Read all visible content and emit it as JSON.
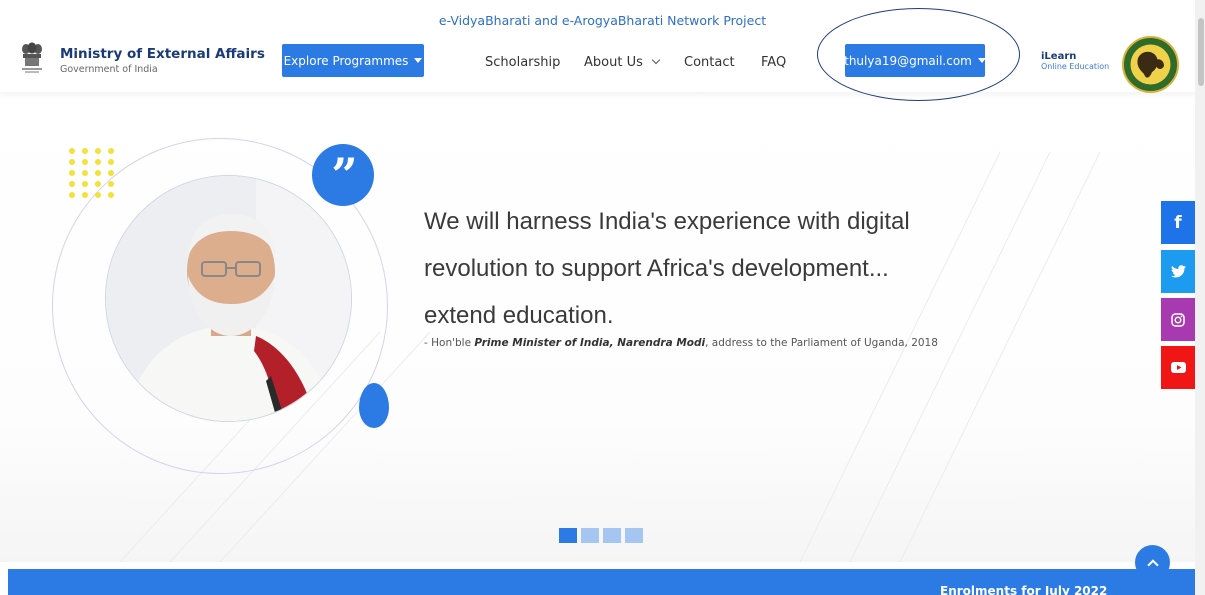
{
  "header": {
    "project_title": "e-VidyaBharati and e-ArogyaBharati Network Project",
    "ministry_name": "Ministry of External Affairs",
    "ministry_sub": "Government of India",
    "explore_label": "Explore Programmes",
    "nav": {
      "scholarship": "Scholarship",
      "about": "About Us",
      "contact": "Contact",
      "faq": "FAQ"
    },
    "user_email": "thulya19@gmail.com",
    "ilearn_title": "iLearn",
    "ilearn_sub": "Online Education"
  },
  "hero": {
    "quote_lines": [
      "We will harness India's experience with digital",
      "revolution to support Africa's development...",
      "extend education."
    ],
    "attribution_prefix": "- Hon'ble ",
    "attribution_name": "Prime Minister of India, Narendra Modi",
    "attribution_suffix": ", address to the Parliament of Uganda, 2018",
    "active_slide": 1,
    "slide_count": 4
  },
  "social": {
    "facebook_glyph": "f"
  },
  "footer_bar": {
    "text": "Enrolments for July 2022"
  },
  "colors": {
    "primary": "#2c7be5",
    "navy": "#1a3a78",
    "facebook": "#1e73e8",
    "twitter": "#1d9bf0",
    "instagram": "#a83ab1",
    "youtube": "#f01616",
    "annotation": "#1f3c88"
  }
}
